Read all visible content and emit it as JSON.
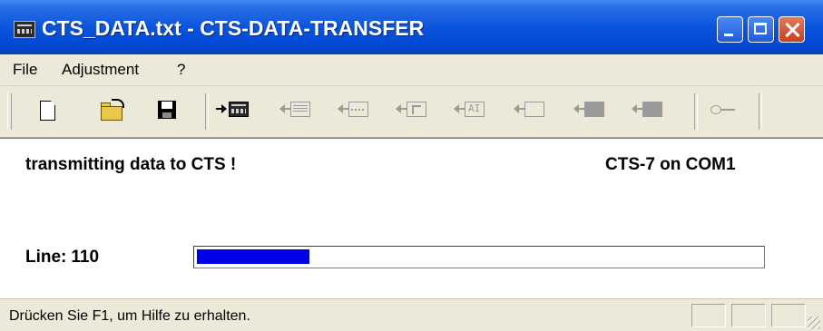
{
  "window": {
    "title": "CTS_DATA.txt - CTS-DATA-TRANSFER"
  },
  "menu": {
    "items": [
      {
        "label": "File"
      },
      {
        "label": "Adjustment"
      },
      {
        "label": "?"
      }
    ]
  },
  "toolbar": {
    "buttons": [
      {
        "icon": "new-document-icon",
        "enabled": true
      },
      {
        "icon": "open-folder-icon",
        "enabled": true
      },
      {
        "icon": "save-disk-icon",
        "enabled": true
      },
      {
        "icon": "send-to-device-icon",
        "enabled": true
      },
      {
        "icon": "receive-from-device-icon",
        "enabled": false
      },
      {
        "icon": "receive-signal-icon",
        "enabled": false
      },
      {
        "icon": "receive-cursor-icon",
        "enabled": false
      },
      {
        "icon": "receive-ai-icon",
        "enabled": false
      },
      {
        "icon": "receive-empty-icon",
        "enabled": false
      },
      {
        "icon": "send-block-icon",
        "enabled": false
      },
      {
        "icon": "send-block-2-icon",
        "enabled": false
      },
      {
        "icon": "key-icon",
        "enabled": false
      }
    ]
  },
  "main": {
    "status_message": "transmitting data to CTS !",
    "device_info": "CTS-7 on COM1",
    "line_label": "Line:",
    "line_number": "110",
    "progress_fraction": 0.2
  },
  "statusbar": {
    "text": "Drücken Sie F1, um Hilfe zu erhalten."
  },
  "colors": {
    "progress_fill": "#0000E6",
    "titlebar": "#0A55DD"
  }
}
